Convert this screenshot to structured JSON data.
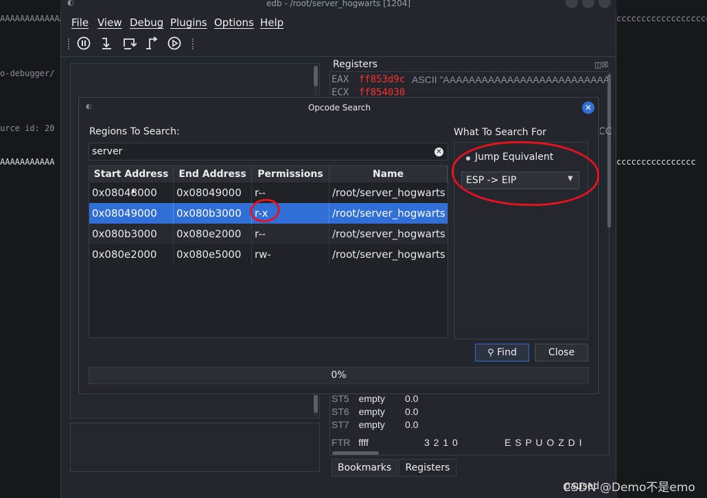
{
  "window": {
    "title": "edb - /root/server_hogwarts [1204]"
  },
  "menu": [
    {
      "label": "File"
    },
    {
      "label": "View"
    },
    {
      "label": "Debug"
    },
    {
      "label": "Plugins"
    },
    {
      "label": "Options"
    },
    {
      "label": "Help"
    }
  ],
  "toolbar": {
    "icons": [
      "pause-icon",
      "step-into-icon",
      "step-over-icon",
      "step-out-icon",
      "run-icon"
    ]
  },
  "terminal": {
    "lines": [
      "AAAAAAAAAAAAAAAAAAAAAAAAAAAAAAAAAAAAAAAAAAAAAAA",
      "o-debugger/",
      "urce id: 20",
      "AAAAAAAAAAA"
    ],
    "right_lines": [
      "cccccccccccccccccccccccc",
      "cccccccccccccccc"
    ]
  },
  "registers": {
    "title": "Registers",
    "rows": [
      {
        "name": "EAX",
        "value": "ff853d9c",
        "comment": "ASCII \"AAAAAAAAAAAAAAAAAAAAAAAAAAAA"
      },
      {
        "name": "ECX",
        "value": "ff854030",
        "comment": ""
      }
    ],
    "fpu": [
      {
        "name": "ST5",
        "state": "empty",
        "value": "0.0"
      },
      {
        "name": "ST6",
        "state": "empty",
        "value": "0.0"
      },
      {
        "name": "ST7",
        "state": "empty",
        "value": "0.0"
      }
    ],
    "ftr": {
      "name": "FTR",
      "value": "ffff",
      "bits": "3 2 1 0",
      "flags": "E S P U O Z D I"
    },
    "side_text": "CC"
  },
  "bottom_tabs": [
    {
      "label": "Bookmarks"
    },
    {
      "label": "Registers"
    }
  ],
  "status": "paused",
  "watermark": "CSDN @Demo不是emo",
  "dialog": {
    "title": "Opcode Search",
    "close_glyph": "✕",
    "regions_label": "Regions To Search:",
    "search_value": "server",
    "clear_glyph": "✕",
    "columns": [
      "Start Address",
      "End Address",
      "Permissions",
      "Name"
    ],
    "sort_glyph": "▲",
    "rows": [
      {
        "start": "0x08048000",
        "end": "0x08049000",
        "perm": "r--",
        "name": "/root/server_hogwarts",
        "selected": false
      },
      {
        "start": "0x08049000",
        "end": "0x080b3000",
        "perm": "r-x",
        "name": "/root/server_hogwarts",
        "selected": true
      },
      {
        "start": "0x080b3000",
        "end": "0x080e2000",
        "perm": "r--",
        "name": "/root/server_hogwarts",
        "selected": false
      },
      {
        "start": "0x080e2000",
        "end": "0x080e5000",
        "perm": "rw-",
        "name": "/root/server_hogwarts",
        "selected": false
      }
    ],
    "search_for_label": "What To Search For",
    "radio_label": "Jump Equivalent",
    "combo_value": "ESP -> EIP",
    "find_label": "Find",
    "close_label": "Close",
    "progress": "0%"
  },
  "colors": {
    "accent": "#2f6fd6",
    "register_changed": "#ff3030",
    "annotation": "#e8121c"
  }
}
